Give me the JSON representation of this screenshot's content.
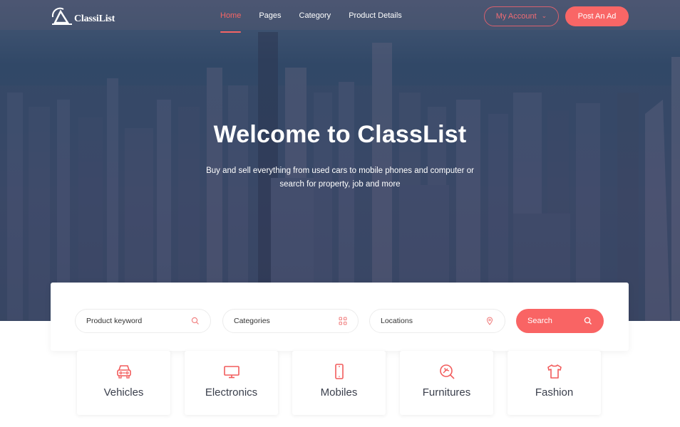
{
  "brand": {
    "name": "ClassiList",
    "accent": "#f96666"
  },
  "nav": {
    "items": [
      {
        "label": "Home",
        "active": true
      },
      {
        "label": "Pages",
        "active": false
      },
      {
        "label": "Category",
        "active": false
      },
      {
        "label": "Product Details",
        "active": false
      }
    ],
    "account_label": "My Account",
    "post_label": "Post An Ad"
  },
  "hero": {
    "title": "Welcome to ClassList",
    "subtitle_line1": "Buy and sell everything from used cars to mobile phones and computer or",
    "subtitle_line2": "search for property, job and more"
  },
  "search": {
    "keyword_placeholder": "Product keyword",
    "category_placeholder": "Categories",
    "location_placeholder": "Locations",
    "button_label": "Search",
    "icons": [
      "search-icon",
      "grid-icon",
      "map-pin-icon",
      "search-icon"
    ]
  },
  "categories": [
    {
      "label": "Vehicles",
      "icon": "car-icon"
    },
    {
      "label": "Electronics",
      "icon": "monitor-icon"
    },
    {
      "label": "Mobiles",
      "icon": "mobile-phone-icon"
    },
    {
      "label": "Furnitures",
      "icon": "furniture-icon"
    },
    {
      "label": "Fashion",
      "icon": "tshirt-icon"
    }
  ]
}
